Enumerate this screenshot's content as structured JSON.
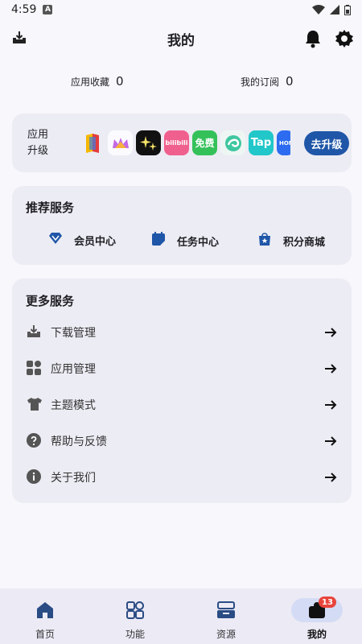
{
  "status_bar": {
    "time": "4:59",
    "notification_letter": "A"
  },
  "header": {
    "title": "我的"
  },
  "stats": {
    "favorites_label": "应用收藏",
    "favorites_count": "0",
    "subscriptions_label": "我的订阅",
    "subscriptions_count": "0"
  },
  "upgrade": {
    "label": "应用升级",
    "apps": [
      {
        "icon": "multicolor-book-app-icon",
        "text": ""
      },
      {
        "icon": "crown-app-icon",
        "text": ""
      },
      {
        "icon": "sparkle-app-icon",
        "text": ""
      },
      {
        "icon": "bilibili-app-icon",
        "text": "bilibili"
      },
      {
        "icon": "free-novel-app-icon",
        "text": "免费"
      },
      {
        "icon": "swirl-app-icon",
        "text": ""
      },
      {
        "icon": "taptap-app-icon",
        "text": "Tap"
      },
      {
        "icon": "honor-app-icon",
        "text": "HON"
      }
    ],
    "button_label": "去升级"
  },
  "recommended": {
    "title": "推荐服务",
    "items": [
      {
        "label": "会员中心",
        "icon": "diamond-icon"
      },
      {
        "label": "任务中心",
        "icon": "task-calendar-icon"
      },
      {
        "label": "积分商城",
        "icon": "star-bag-icon"
      }
    ]
  },
  "more": {
    "title": "更多服务",
    "items": [
      {
        "label": "下载管理",
        "icon": "download-tray-icon"
      },
      {
        "label": "应用管理",
        "icon": "apps-grid-icon"
      },
      {
        "label": "主题模式",
        "icon": "tshirt-icon"
      },
      {
        "label": "帮助与反馈",
        "icon": "help-circle-icon"
      },
      {
        "label": "关于我们",
        "icon": "info-circle-icon"
      }
    ]
  },
  "bottom_nav": {
    "items": [
      {
        "label": "首页",
        "icon": "home-icon"
      },
      {
        "label": "功能",
        "icon": "features-grid-icon"
      },
      {
        "label": "资源",
        "icon": "resources-box-icon"
      },
      {
        "label": "我的",
        "icon": "profile-icon",
        "badge": "13",
        "active": true
      }
    ]
  },
  "colors": {
    "accent": "#1f56a8",
    "badge": "#e8453c",
    "card_bg": "#ececf4",
    "page_bg": "#f7f7fc"
  }
}
